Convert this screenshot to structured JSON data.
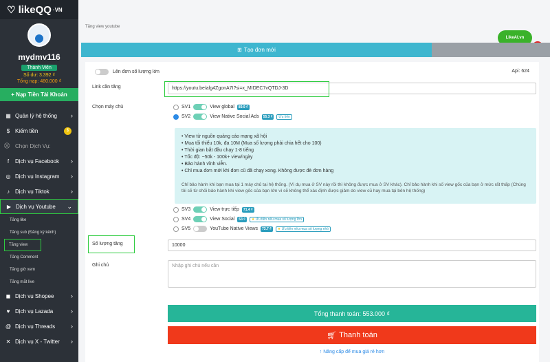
{
  "logo": {
    "text": "likeQQ",
    "suffix": "·VN"
  },
  "user": {
    "name": "mydmv116",
    "role": "Thành Viên",
    "balance": "Số dư: 3.392 ₫",
    "total_topup": "Tổng nạp: 480.000 ₫",
    "topup_button": "+ Nạp Tiền Tài Khoản"
  },
  "sidebar": {
    "system": "Quản lý hệ thống",
    "earn": "Kiếm tiền",
    "coin": "$",
    "section": "Chọn Dịch Vụ:",
    "services": [
      "Dịch vụ Facebook",
      "Dịch vụ Instagram",
      "Dịch vụ Tiktok",
      "Dịch vụ Youtube"
    ],
    "youtube_sub": [
      "Tăng like",
      "Tăng sub (Đăng ký kênh)",
      "Tăng view",
      "Tăng Comment",
      "Tăng giờ xem",
      "Tăng mắt live"
    ],
    "more_services": [
      "Dịch vụ Shopee",
      "Dịch vụ Lazada",
      "Dịch vụ Threads",
      "Dịch vụ X - Twitter"
    ]
  },
  "breadcrumb": "Tăng view youtube",
  "tabs": {
    "create": "Tạo đơn mới"
  },
  "likeai": "LikeAI.vn",
  "form": {
    "bulk_toggle": "Lên đơn số lượng lớn",
    "api": "Api: 624",
    "link_label": "Link cần tăng",
    "link_value": "https://youtu.be/alg4ZgonA7I?si=x_MIDEC7vQTDJ-3D",
    "server_label": "Chọn máy chủ",
    "servers": [
      {
        "code": "SV1",
        "name": "View global",
        "price": "89.9 ₫",
        "tag": ""
      },
      {
        "code": "SV2",
        "name": "View Native Social Ads",
        "price": "55.3 ₫",
        "tag": "Ưu tiên"
      },
      {
        "code": "SV3",
        "name": "View trực tiếp",
        "price": "71.4 ₫",
        "tag": ""
      },
      {
        "code": "SV4",
        "name": "View Social",
        "price": "53 ₫",
        "tag": "Ưu tiên nếu mua số lượng lớn"
      },
      {
        "code": "SV5",
        "name": "YouTube Native Views",
        "price": "73.7 ₫",
        "tag": "Ưu tiên nếu mua số lượng nhỏ"
      }
    ],
    "info_lines": [
      "View từ nguồn quảng cáo mạng xã hội",
      "Mua tối thiểu 10k, đa 10M (Mua số lượng phải chia hết cho 100)",
      "Thời gian bắt đầu chạy 1-8 tiếng",
      "Tốc độ: ~50k - 100k+ view/ngày",
      "Bảo hành vĩnh viễn.",
      "Chỉ mua đơn mới khi đơn cũ đã chạy xong. Không được đè đơn hàng"
    ],
    "info_note": "Chỉ bảo hành khi bạn mua tại 1 máy chủ tại hệ thống. (Ví dụ mua ở SV này rồi thì không được mua ở SV khác). Chỉ bảo hành khi số view gốc của bạn ở mức rất thấp (Chúng tôi sẽ từ chối bảo hành khi view gốc của bạn lớn vì sẽ không thể xác định được giảm do view cũ hay mua tại bên hệ thống)",
    "qty_label": "Số lượng tăng",
    "qty_value": "10000",
    "note_label": "Ghi chú",
    "note_placeholder": "Nhập ghi chú nếu cần",
    "total": "Tổng thanh toán: 553.000  ₫",
    "pay": "Thanh toán",
    "upgrade": "↑ Nâng cấp để mua giá rẻ hơn"
  },
  "colors": {
    "accent": "#3eb6cf",
    "pay": "#f0391b",
    "total": "#26b598",
    "highlight": "#2ecc40"
  }
}
